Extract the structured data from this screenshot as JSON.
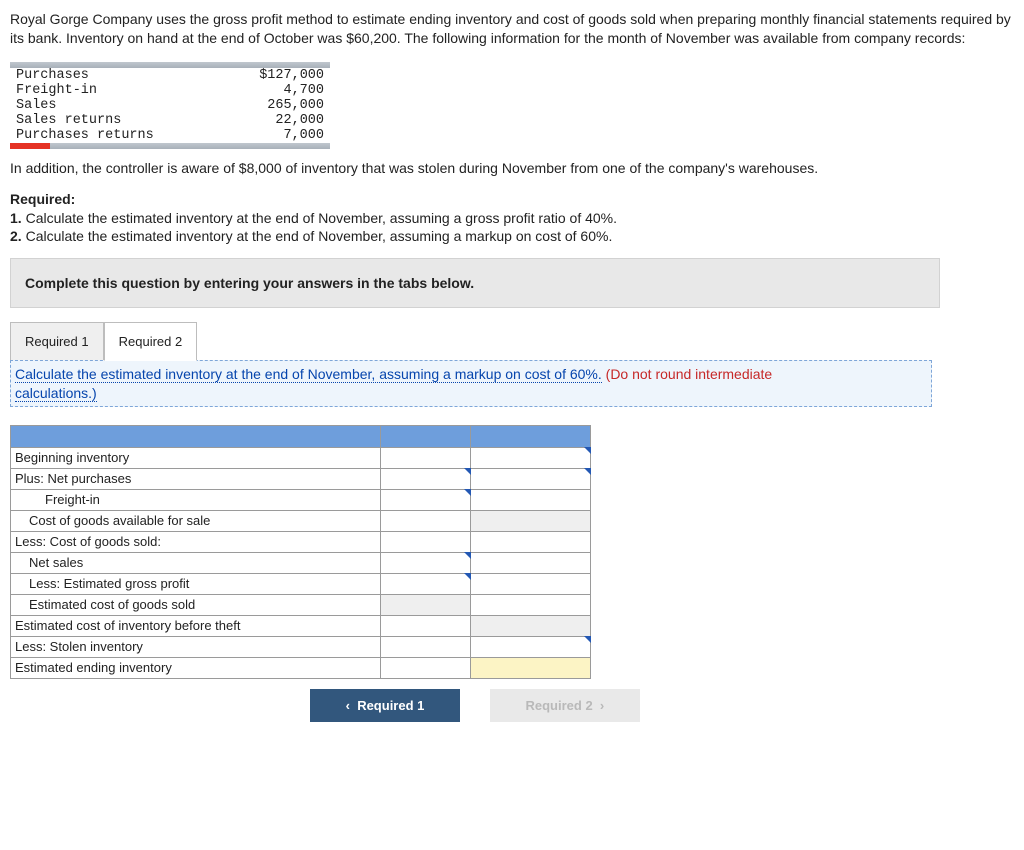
{
  "problem": {
    "intro": "Royal Gorge Company uses the gross profit method to estimate ending inventory and cost of goods sold when preparing monthly financial statements required by its bank. Inventory on hand at the end of October was $60,200. The following information for the month of November was available from company records:"
  },
  "given": {
    "rows": [
      {
        "label": "Purchases",
        "value": "$127,000"
      },
      {
        "label": "Freight-in",
        "value": "4,700"
      },
      {
        "label": "Sales",
        "value": "265,000"
      },
      {
        "label": "Sales returns",
        "value": "22,000"
      },
      {
        "label": "Purchases returns",
        "value": "7,000"
      }
    ]
  },
  "extra": "In addition, the controller is aware of $8,000 of inventory that was stolen during November from one of the company's warehouses.",
  "required": {
    "heading": "Required:",
    "items": [
      "Calculate the estimated inventory at the end of November, assuming a gross profit ratio of 40%.",
      "Calculate the estimated inventory at the end of November, assuming a markup on cost of 60%."
    ]
  },
  "instruction_bar": "Complete this question by entering your answers in the tabs below.",
  "tabs": {
    "t1": "Required 1",
    "t2": "Required 2"
  },
  "tab_instruction": {
    "main_link": "Calculate the estimated inventory at the end of November, assuming a markup on cost of 60%.",
    "warn": "(Do not round intermediate ",
    "tail_link": "calculations.)"
  },
  "answer_rows": {
    "r1": "Beginning inventory",
    "r2": "Plus: Net purchases",
    "r3": "Freight-in",
    "r4": "Cost of goods available for sale",
    "r5": "Less: Cost of goods sold:",
    "r6": "Net sales",
    "r7": "Less: Estimated gross profit",
    "r8": "Estimated cost of goods sold",
    "r9": "Estimated cost of inventory before theft",
    "r10": "Less: Stolen inventory",
    "r11": "Estimated ending inventory"
  },
  "nav": {
    "prev": "Required 1",
    "next": "Required 2"
  }
}
